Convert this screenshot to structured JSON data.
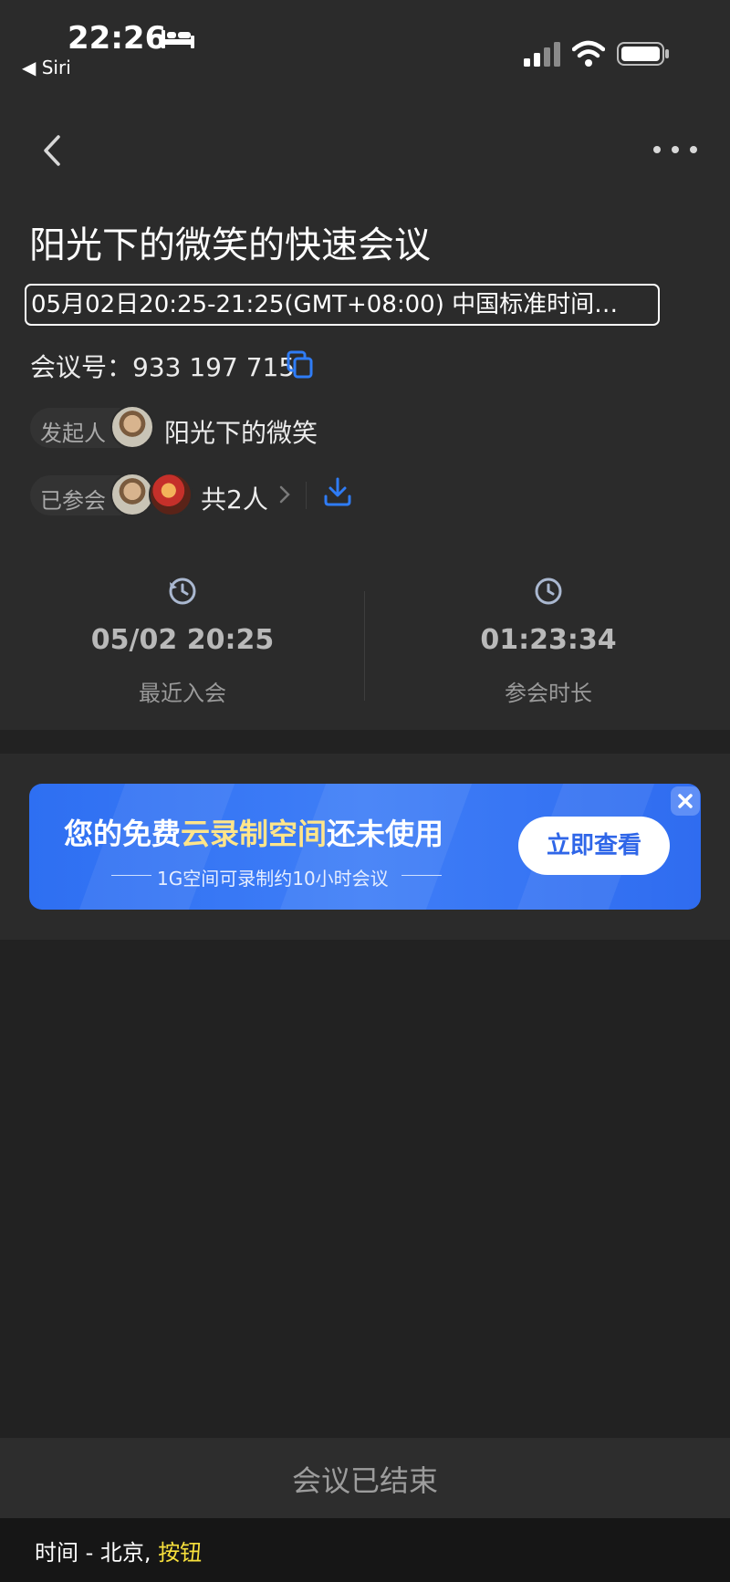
{
  "status_bar": {
    "time": "22:26",
    "back_app": "◀ Siri",
    "icons": [
      "bed-icon",
      "signal-icon",
      "wifi-icon",
      "battery-icon"
    ]
  },
  "nav": {
    "back_icon": "chevron-left-icon",
    "more_icon": "more-dots-icon"
  },
  "meeting": {
    "title": "阳光下的微笑的快速会议",
    "time_range": "05月02日20:25-21:25(GMT+08:00) 中国标准时间…",
    "id_label": "会议号：",
    "id_value": "933 197 715",
    "host_label": "发起人",
    "host_name": "阳光下的微笑",
    "participants_label": "已参会",
    "participants_count": "共2人"
  },
  "stats": {
    "last_join_value": "05/02 20:25",
    "last_join_label": "最近入会",
    "duration_value": "01:23:34",
    "duration_label": "参会时长"
  },
  "promo": {
    "title_prefix": "您的免费",
    "title_highlight": "云录制空间",
    "title_suffix": "还未使用",
    "subtitle": "1G空间可录制约10小时会议",
    "cta_label": "立即查看"
  },
  "footer": {
    "status_text": "会议已结束"
  },
  "voiceover": {
    "text": "时间 - 北京,",
    "role": "按钮"
  },
  "colors": {
    "background": "#222222",
    "panel": "#2b2b2b",
    "accent_blue": "#2f6ff0",
    "highlight_yellow": "#ffe58a"
  }
}
